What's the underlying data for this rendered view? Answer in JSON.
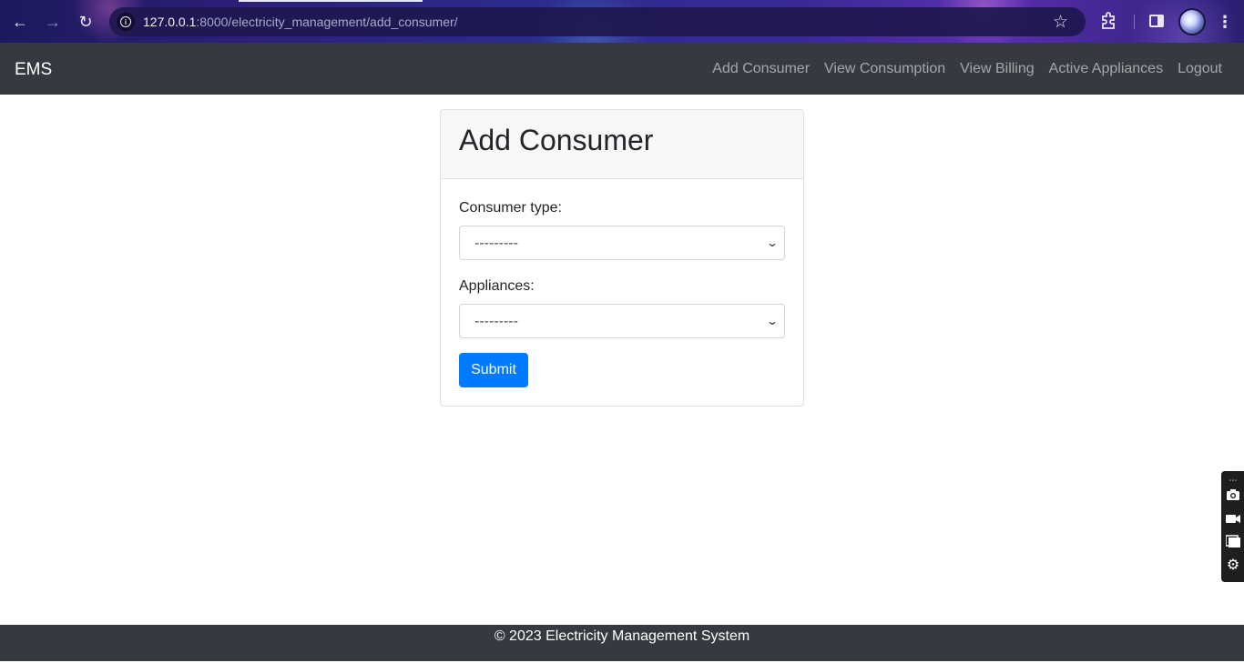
{
  "browser": {
    "url_host": "127.0.0.1",
    "url_rest": ":8000/electricity_management/add_consumer/",
    "back_icon": "←",
    "forward_icon": "→",
    "reload_icon": "↻",
    "star_icon": "☆",
    "menu_icon": "⋮"
  },
  "navbar": {
    "brand": "EMS",
    "links": [
      {
        "label": "Add Consumer"
      },
      {
        "label": "View Consumption"
      },
      {
        "label": "View Billing"
      },
      {
        "label": "Active Appliances"
      },
      {
        "label": "Logout"
      }
    ]
  },
  "form": {
    "title": "Add Consumer",
    "consumer_type": {
      "label": "Consumer type:",
      "selected": "---------"
    },
    "appliances": {
      "label": "Appliances:",
      "selected": "---------"
    },
    "submit_label": "Submit"
  },
  "footer": {
    "text": "© 2023 Electricity Management System"
  },
  "colors": {
    "navbar_bg": "#343a40",
    "primary": "#007bff",
    "card_header_bg": "#f7f7f7"
  }
}
